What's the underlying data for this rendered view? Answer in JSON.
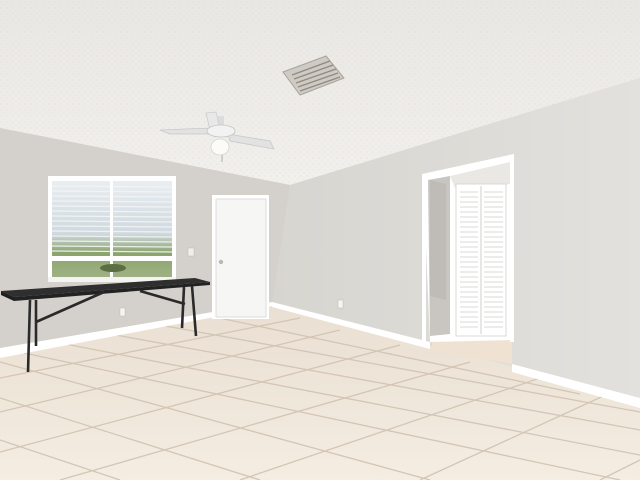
{
  "scene": {
    "description_label": "",
    "colors": {
      "ceiling": "#eceae6",
      "wall_left": "#d6d3ce",
      "wall_right": "#dcdad5",
      "floor_tile": "#f1e8dc",
      "grout": "#d9cbbb",
      "baseboard": "#ffffff",
      "door": "#f7f7f5",
      "table": "#2b2b2b",
      "window_frame": "#ffffff",
      "sky": "#dfe8ee",
      "grass": "#7d9a5e"
    },
    "objects": [
      "ceiling-fan",
      "air-vent",
      "window-with-blinds",
      "front-door",
      "folding-table",
      "closet-bifold-door",
      "tile-floor",
      "baseboards",
      "wall-outlet"
    ]
  }
}
